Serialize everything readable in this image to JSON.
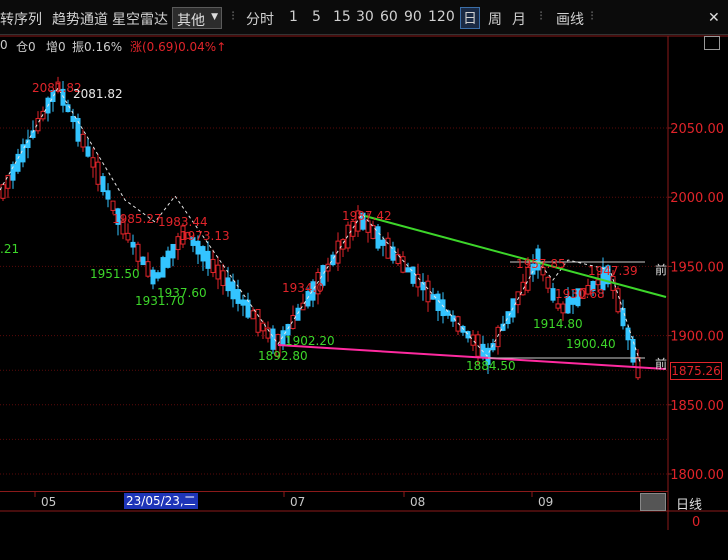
{
  "toolbar": {
    "items_left": [
      "转序列",
      "趋势通道",
      "星空雷达"
    ],
    "combo_value": "其他",
    "period_prefix": "分时",
    "periods": [
      "1",
      "5",
      "15",
      "30",
      "60",
      "90",
      "120",
      "日",
      "周",
      "月"
    ],
    "selected_period": "日",
    "draw_label": "画线",
    "close_label": "✕"
  },
  "infobar": {
    "f0": "0",
    "f1": "仓0",
    "f2": "增0",
    "f3": "振0.16%",
    "change": "涨(0.69)0.04%↑"
  },
  "chart_data": {
    "type": "candlestick",
    "price_axis_ticks": [
      "2050.00",
      "2000.00",
      "1950.00",
      "1900.00",
      "1850.00",
      "1800.00"
    ],
    "ylim": [
      1788,
      2105
    ],
    "time_ticks": [
      "05",
      "07",
      "08",
      "09"
    ],
    "annotations_red": [
      "2081.82",
      "1985.27",
      "1983.44",
      "1973.13",
      "1934.0",
      "1987.42",
      "1957.85",
      "1930.68",
      "1947.39"
    ],
    "annotations_green": [
      "1951.50",
      "1931.70",
      "1937.60",
      "1902.20",
      "1892.80",
      "1884.50",
      "1914.80",
      "1900.40"
    ],
    "annotations_white": [
      "2081.82"
    ],
    "left_partial": ".21",
    "current_price": "1875.26",
    "front_label": "前",
    "colors": {
      "up": "#e0242a",
      "down": "#33c4ff",
      "trend_green": "#3dd62a",
      "trend_pink": "#ff2aa0",
      "grid": "#5a0a0a"
    }
  },
  "axis": {
    "cursor_date": "23/05/23,二",
    "period_name": "日线",
    "bottom_value": "0"
  }
}
